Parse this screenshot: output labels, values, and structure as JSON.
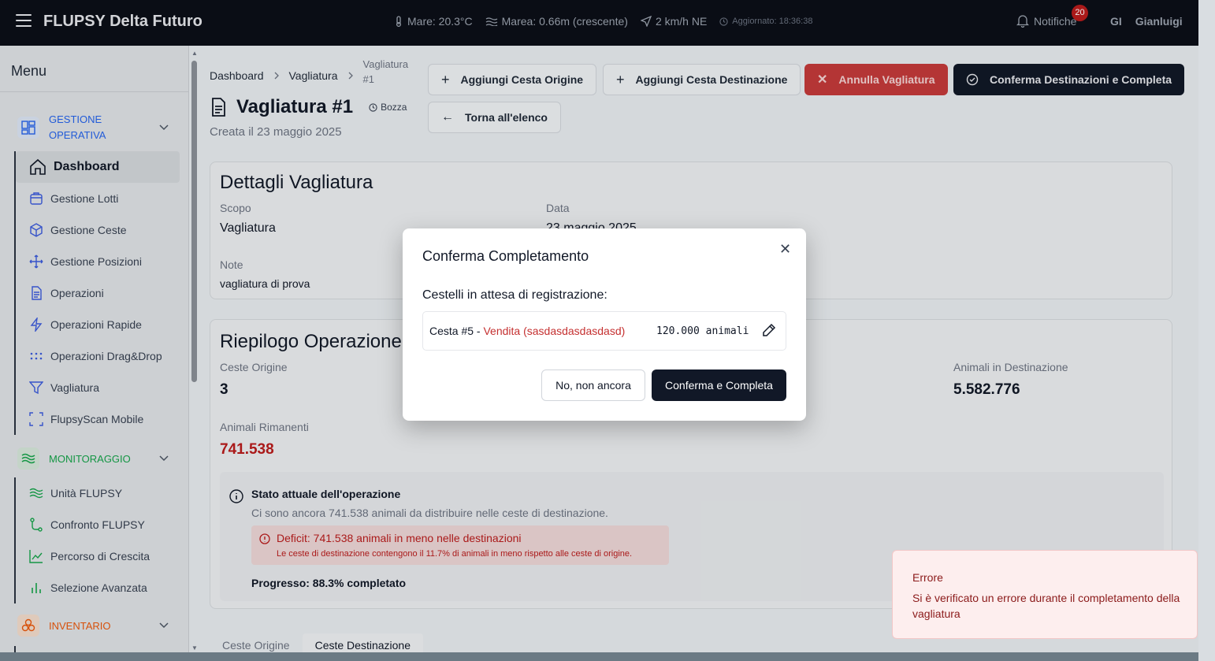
{
  "header": {
    "app_title": "FLUPSY Delta Futuro",
    "sea_temp": "Mare: 20.3°C",
    "tide": "Marea: 0.66m (crescente)",
    "wind": "2 km/h NE",
    "updated": "Aggiornato: 18:36:38",
    "notifications_label": "Notifiche",
    "notifications_count": "20",
    "user_initials": "GI",
    "user_name": "Gianluigi"
  },
  "sidebar": {
    "title": "Menu",
    "sections": [
      {
        "title": "GESTIONE OPERATIVA",
        "color": "#2563eb"
      },
      {
        "title": "MONITORAGGIO",
        "color": "#16a34a"
      },
      {
        "title": "INVENTARIO",
        "color": "#ea580c"
      }
    ],
    "operativa_items": [
      {
        "label": "Dashboard",
        "icon": "home-icon"
      },
      {
        "label": "Gestione Lotti",
        "icon": "package-icon"
      },
      {
        "label": "Gestione Ceste",
        "icon": "box-icon"
      },
      {
        "label": "Gestione Posizioni",
        "icon": "move-icon"
      },
      {
        "label": "Operazioni",
        "icon": "file-icon"
      },
      {
        "label": "Operazioni Rapide",
        "icon": "bolt-icon"
      },
      {
        "label": "Operazioni Drag&Drop",
        "icon": "grip-icon"
      },
      {
        "label": "Vagliatura",
        "icon": "filter-icon"
      },
      {
        "label": "FlupsyScan Mobile",
        "icon": "scan-icon"
      }
    ],
    "monitoraggio_items": [
      {
        "label": "Unità FLUPSY",
        "icon": "waves-icon"
      },
      {
        "label": "Confronto FLUPSY",
        "icon": "compare-icon"
      },
      {
        "label": "Percorso di Crescita",
        "icon": "line-chart-icon"
      },
      {
        "label": "Selezione Avanzata",
        "icon": "bar-chart-icon"
      }
    ]
  },
  "breadcrumb": [
    "Dashboard",
    "Vagliatura",
    "Vagliatura #1"
  ],
  "page": {
    "title": "Vagliatura #1",
    "status": "Bozza",
    "created": "Creata il 23 maggio 2025"
  },
  "toolbar": {
    "add_origin": "Aggiungi Cesta Origine",
    "add_dest": "Aggiungi Cesta Destinazione",
    "cancel": "Annulla Vagliatura",
    "confirm": "Conferma Destinazioni e Completa",
    "back": "Torna all'elenco"
  },
  "details": {
    "title": "Dettagli Vagliatura",
    "scope_label": "Scopo",
    "scope_value": "Vagliatura",
    "date_label": "Data",
    "date_value": "23 maggio 2025",
    "notes_label": "Note",
    "notes_value": "vagliatura di prova"
  },
  "summary": {
    "title": "Riepilogo Operazione",
    "origin_label": "Ceste Origine",
    "origin_value": "3",
    "dest_animals_label": "Animali in Destinazione",
    "dest_animals_value": "5.582.776",
    "remaining_label": "Animali Rimanenti",
    "remaining_value": "741.538",
    "status_title": "Stato attuale dell'operazione",
    "status_text": "Ci sono ancora 741.538 animali da distribuire nelle ceste di destinazione.",
    "deficit_title": "Deficit: 741.538 animali in meno nelle destinazioni",
    "deficit_text": "Le ceste di destinazione contengono il 11.7% di animali in meno rispetto alle ceste di origine.",
    "progress": "Progresso: 88.3% completato"
  },
  "tabs": [
    "Ceste Origine",
    "Ceste Destinazione"
  ],
  "modal": {
    "title": "Conferma Completamento",
    "subtitle": "Cestelli in attesa di registrazione:",
    "row_basket": "Cesta #5 - ",
    "row_dest": "Vendita (sasdasdasdasdasd)",
    "row_count": "120.000 animali",
    "no_label": "No, non ancora",
    "yes_label": "Conferma e Completa"
  },
  "toast": {
    "title": "Errore",
    "message": "Si è verificato un errore durante il completamento della vagliatura"
  }
}
